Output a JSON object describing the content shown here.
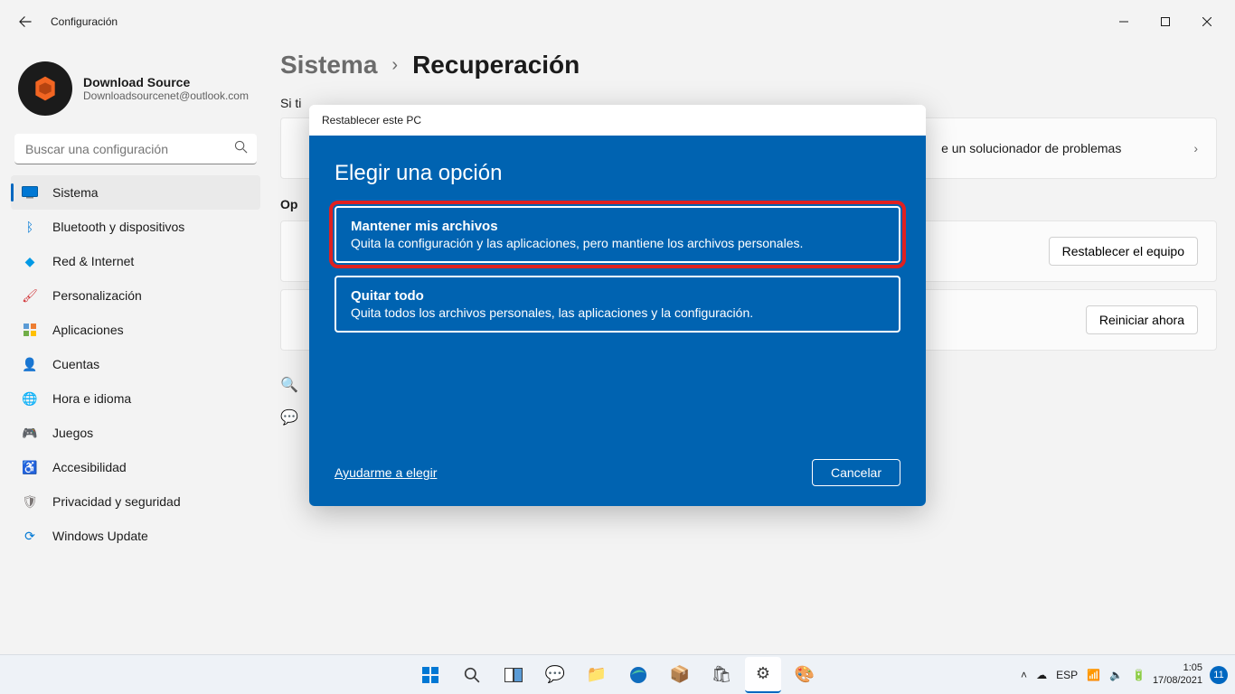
{
  "titlebar": {
    "title": "Configuración"
  },
  "user": {
    "name": "Download Source",
    "email": "Downloadsourcenet@outlook.com"
  },
  "search": {
    "placeholder": "Buscar una configuración"
  },
  "nav": {
    "items": [
      {
        "label": "Sistema"
      },
      {
        "label": "Bluetooth y dispositivos"
      },
      {
        "label": "Red & Internet"
      },
      {
        "label": "Personalización"
      },
      {
        "label": "Aplicaciones"
      },
      {
        "label": "Cuentas"
      },
      {
        "label": "Hora e idioma"
      },
      {
        "label": "Juegos"
      },
      {
        "label": "Accesibilidad"
      },
      {
        "label": "Privacidad y seguridad"
      },
      {
        "label": "Windows Update"
      }
    ]
  },
  "breadcrumb": {
    "parent": "Sistema",
    "current": "Recuperación"
  },
  "hint_prefix": "Si ti",
  "troubleshoot": {
    "tail": "e un solucionador de problemas"
  },
  "section_label_prefix": "Op",
  "reset_btn": "Restablecer el equipo",
  "restart_btn": "Reiniciar ahora",
  "dialog": {
    "title": "Restablecer este PC",
    "heading": "Elegir una opción",
    "opt1": {
      "title": "Mantener mis archivos",
      "desc": "Quita la configuración y las aplicaciones, pero mantiene los archivos personales."
    },
    "opt2": {
      "title": "Quitar todo",
      "desc": "Quita todos los archivos personales, las aplicaciones y la configuración."
    },
    "help": "Ayudarme a elegir",
    "cancel": "Cancelar"
  },
  "taskbar": {
    "lang": "ESP",
    "time": "1:05",
    "date": "17/08/2021",
    "badge": "11"
  }
}
